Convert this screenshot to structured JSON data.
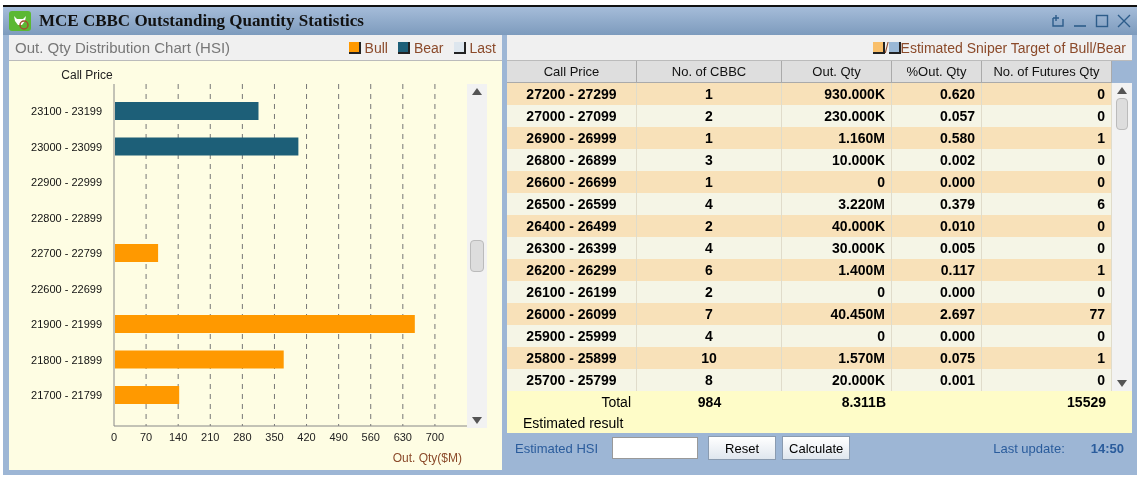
{
  "window": {
    "title": "MCE CBBC Outstanding Quantity Statistics"
  },
  "chart_panel": {
    "title": "Out. Qty Distribution Chart (HSI)",
    "last_legend": {
      "label": "Last",
      "color": "#dde6ee"
    },
    "chart_data": {
      "type": "bar",
      "orientation": "horizontal",
      "grid": true,
      "xlabel": "Out. Qty($M)",
      "ylabel": "Call Price",
      "categories": [
        "23100 - 23199",
        "23000 - 23099",
        "22900 - 22999",
        "22800 - 22899",
        "22700 - 22799",
        "22600 - 22699",
        "21900 - 21999",
        "21800 - 21899",
        "21700 - 21799"
      ],
      "series": [
        {
          "name": "Bull",
          "color": "#ff9900",
          "values": [
            null,
            null,
            null,
            null,
            94,
            null,
            654,
            368,
            140
          ]
        },
        {
          "name": "Bear",
          "color": "#1d5f78",
          "values": [
            313,
            400,
            null,
            null,
            null,
            null,
            null,
            null,
            null
          ]
        }
      ],
      "xlim": [
        0,
        770
      ],
      "xticks": [
        0,
        70,
        140,
        210,
        280,
        350,
        420,
        490,
        560,
        630,
        700
      ]
    }
  },
  "table_panel": {
    "legend": {
      "separator": "/",
      "label": "Estimated Sniper Target of Bull/Bear",
      "swatches": [
        {
          "color": "#f9bf6a"
        },
        {
          "color": "#9ab8d6"
        }
      ]
    },
    "columns": [
      "Call Price",
      "No. of CBBC",
      "Out. Qty",
      "%Out. Qty",
      "No. of Futures Qty"
    ],
    "rows": [
      [
        "27200 - 27299",
        "1",
        "930.000K",
        "0.620",
        "0"
      ],
      [
        "27000 - 27099",
        "2",
        "230.000K",
        "0.057",
        "0"
      ],
      [
        "26900 - 26999",
        "1",
        "1.160M",
        "0.580",
        "1"
      ],
      [
        "26800 - 26899",
        "3",
        "10.000K",
        "0.002",
        "0"
      ],
      [
        "26600 - 26699",
        "1",
        "0",
        "0.000",
        "0"
      ],
      [
        "26500 - 26599",
        "4",
        "3.220M",
        "0.379",
        "6"
      ],
      [
        "26400 - 26499",
        "2",
        "40.000K",
        "0.010",
        "0"
      ],
      [
        "26300 - 26399",
        "4",
        "30.000K",
        "0.005",
        "0"
      ],
      [
        "26200 - 26299",
        "6",
        "1.400M",
        "0.117",
        "1"
      ],
      [
        "26100 - 26199",
        "2",
        "0",
        "0.000",
        "0"
      ],
      [
        "26000 - 26099",
        "7",
        "40.450M",
        "2.697",
        "77"
      ],
      [
        "25900 - 25999",
        "4",
        "0",
        "0.000",
        "0"
      ],
      [
        "25800 - 25899",
        "10",
        "1.570M",
        "0.075",
        "1"
      ],
      [
        "25700 - 25799",
        "8",
        "20.000K",
        "0.001",
        "0"
      ]
    ],
    "total": {
      "label": "Total",
      "count": "984",
      "qty": "8.311B",
      "futures": "15529"
    },
    "estimated_label": "Estimated result"
  },
  "bottom_bar": {
    "hsi_label": "Estimated HSI",
    "buttons": [
      "Reset",
      "Calculate"
    ],
    "update_label": "Last update:",
    "update_time": "14:50"
  }
}
